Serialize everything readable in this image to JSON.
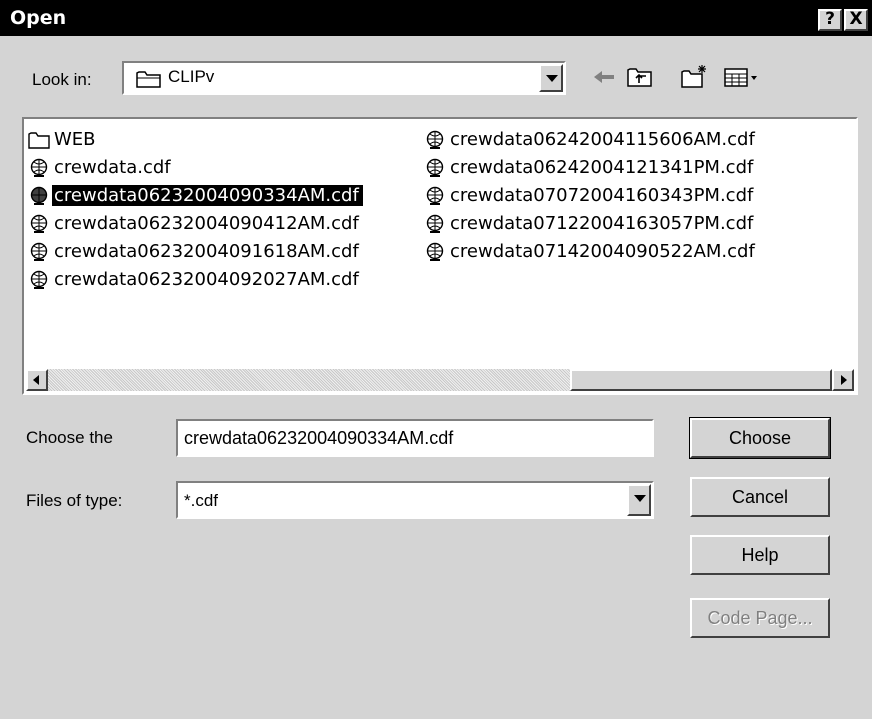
{
  "dialog": {
    "title": "Open",
    "help_glyph": "?",
    "close_glyph": "X"
  },
  "lookin": {
    "label": "Look in:",
    "value": "CLIPv"
  },
  "files": [
    {
      "name": "WEB",
      "type": "folder"
    },
    {
      "name": "crewdata.cdf",
      "type": "file"
    },
    {
      "name": "crewdata06232004090334AM.cdf",
      "type": "file",
      "selected": true
    },
    {
      "name": "crewdata06232004090412AM.cdf",
      "type": "file"
    },
    {
      "name": "crewdata06232004091618AM.cdf",
      "type": "file"
    },
    {
      "name": "crewdata06232004092027AM.cdf",
      "type": "file"
    },
    {
      "name": "crewdata06242004115606AM.cdf",
      "type": "file"
    },
    {
      "name": "crewdata06242004121341PM.cdf",
      "type": "file"
    },
    {
      "name": "crewdata07072004160343PM.cdf",
      "type": "file"
    },
    {
      "name": "crewdata07122004163057PM.cdf",
      "type": "file"
    },
    {
      "name": "crewdata07142004090522AM.cdf",
      "type": "file"
    }
  ],
  "filename": {
    "label": "Choose the",
    "value": "crewdata06232004090334AM.cdf"
  },
  "filetype": {
    "label": "Files of type:",
    "value": "*.cdf"
  },
  "buttons": {
    "choose": "Choose",
    "cancel": "Cancel",
    "help": "Help",
    "codepage": "Code Page..."
  },
  "icons": {
    "folder": "folder-icon",
    "file": "globe-file-icon",
    "back": "back-arrow-icon",
    "up": "up-folder-icon",
    "new_folder": "new-folder-icon",
    "view": "view-menu-icon"
  }
}
